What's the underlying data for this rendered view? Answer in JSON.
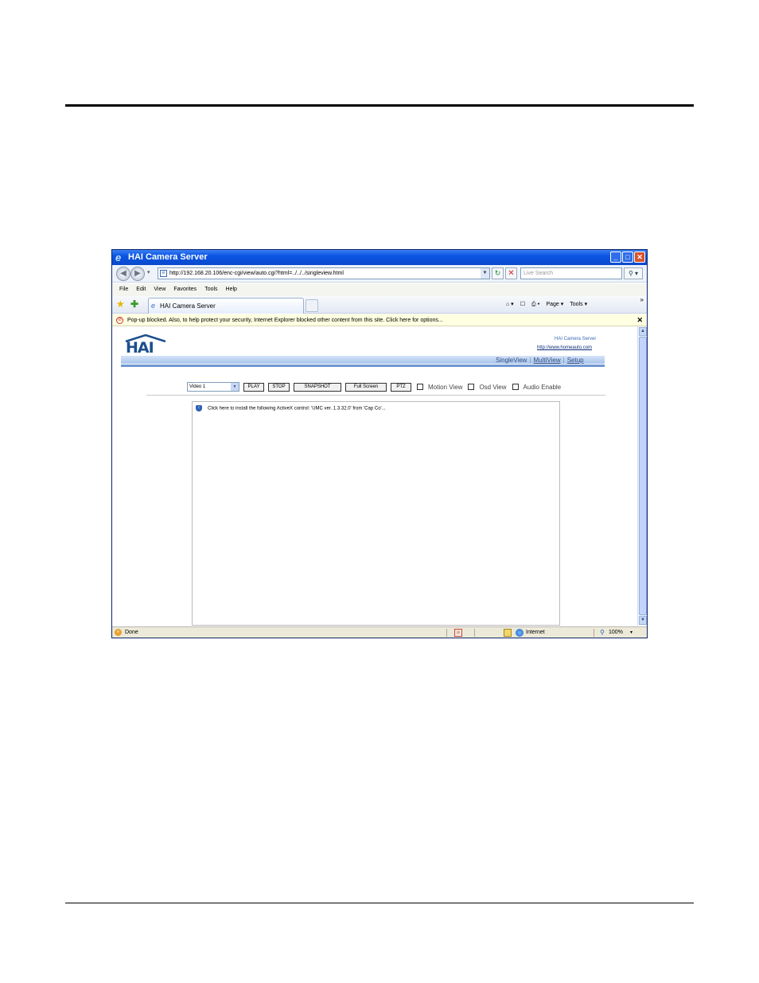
{
  "window": {
    "title": "HAI Camera Server",
    "controls": [
      "_",
      "□",
      "✕"
    ]
  },
  "address_bar": {
    "url": "http://192.168.20.106/enc-cgi/view/auto.cgi?html=../../../singleview.html",
    "search_placeholder": "Live Search",
    "refresh_glyph": "↻",
    "stop_glyph": "✕",
    "search_glyph": "⚲ ▾"
  },
  "menu": [
    "File",
    "Edit",
    "View",
    "Favorites",
    "Tools",
    "Help"
  ],
  "favorites_bar": {
    "tab_title": "HAI Camera Server",
    "commands": [
      "⌂ ▾",
      "☐",
      "⎙ ▾",
      "Page ▾",
      "Tools ▾"
    ],
    "chevron": "»"
  },
  "infobar": {
    "text": "Pop-up blocked. Also, to help protect your security, Internet Explorer blocked other content from this site. Click here for options...",
    "close": "✕"
  },
  "page": {
    "brand_name": "HAI Camera Server",
    "brand_url": "http://www.homeauto.com",
    "logo_text": "HAI",
    "nav": {
      "single": "SingleView",
      "multi": "MultiView",
      "setup": "Setup",
      "separator": "|"
    },
    "controls": {
      "video_select": "Video 1",
      "play": "PLAY",
      "stop": "STOP",
      "snapshot": "SNAPSHOT",
      "full_screen": "Full Screen",
      "ptz": "PTZ",
      "motion_view": "Motion View",
      "osd_view": "Osd View",
      "audio_enable": "Audio Enable"
    },
    "activex_message": "Click here to install the following ActiveX control: 'UMC ver. 1.3.32.0' from 'Cap Co'..."
  },
  "status_bar": {
    "status": "Done",
    "zone": "Internet",
    "zoom": "100%",
    "zoom_dropdown": "▾"
  }
}
